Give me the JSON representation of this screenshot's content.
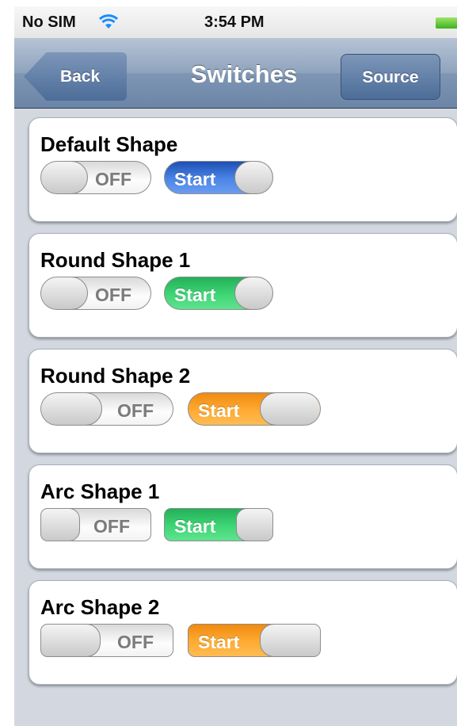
{
  "status_bar": {
    "carrier": "No SIM",
    "time": "3:54 PM",
    "wifi_icon": "wifi-icon",
    "battery_icon": "battery-icon",
    "battery_color": "#4cc22a"
  },
  "nav": {
    "back_label": "Back",
    "title": "Switches",
    "source_label": "Source"
  },
  "colors": {
    "blue": "#3b74dc",
    "green": "#3fd676",
    "orange": "#ffab33"
  },
  "sections": [
    {
      "title": "Default Shape",
      "off_label": "OFF",
      "on_label": "Start",
      "on_color": "blue"
    },
    {
      "title": "Round Shape 1",
      "off_label": "OFF",
      "on_label": "Start",
      "on_color": "green"
    },
    {
      "title": "Round Shape 2",
      "off_label": "OFF",
      "on_label": "Start",
      "on_color": "orange"
    },
    {
      "title": "Arc Shape 1",
      "off_label": "OFF",
      "on_label": "Start",
      "on_color": "green"
    },
    {
      "title": "Arc Shape 2",
      "off_label": "OFF",
      "on_label": "Start",
      "on_color": "orange"
    }
  ]
}
